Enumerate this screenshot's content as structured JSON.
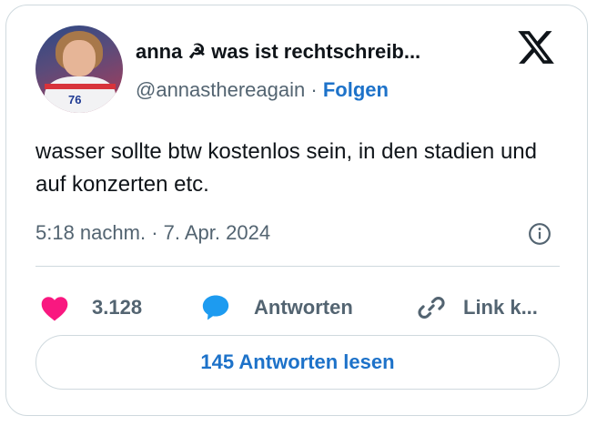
{
  "author": {
    "display_name": "anna ☭ was ist rechtschreib...",
    "handle": "@annasthereagain",
    "separator": "·",
    "follow_label": "Folgen"
  },
  "tweet": {
    "text": "wasser sollte btw kostenlos sein, in den stadien und auf konzerten etc.",
    "timestamp": "5:18 nachm. · 7. Apr. 2024"
  },
  "actions": {
    "like_count": "3.128",
    "reply_label": "Antworten",
    "link_label": "Link k..."
  },
  "read_replies_label": "145 Antworten lesen",
  "colors": {
    "accent": "#1d72c9",
    "like": "#f91880",
    "reply": "#1d9bf0",
    "muted": "#536471",
    "border": "#cfd9de"
  },
  "icons": [
    "x-logo-icon",
    "info-icon",
    "heart-icon",
    "speech-bubble-icon",
    "link-icon"
  ]
}
